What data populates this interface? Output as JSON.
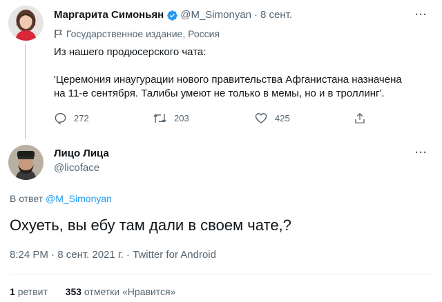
{
  "tweet1": {
    "author_name": "Маргарита Симоньян",
    "author_handle": "@M_Simonyan",
    "separator": "·",
    "date": "8 сент.",
    "label": "Государственное издание, Россия",
    "text_line1": "Из нашего продюсерского чата:",
    "text_line2": "'Церемония инаугурации нового правительства Афганистана назначена",
    "text_line3": "на 11-е сентября. Талибы умеют не только в мемы, но и в троллинг'.",
    "replies": "272",
    "retweets": "203",
    "likes": "425",
    "icons": [
      "verified-badge-icon",
      "flag-icon",
      "reply-icon",
      "retweet-icon",
      "like-icon",
      "share-icon",
      "more-icon"
    ]
  },
  "tweet2": {
    "author_name": "Лицо Лица",
    "author_handle": "@licoface",
    "reply_prefix": "В ответ",
    "reply_handle": "@M_Simonyan",
    "text": "Охуеть, вы ебу там дали в своем чате,?",
    "time": "8:24 PM",
    "separator": "·",
    "date": "8 сент. 2021 г.",
    "separator2": "·",
    "source": "Twitter for Android",
    "retweet_count": "1",
    "retweet_label": "ретвит",
    "like_count": "353",
    "like_label": "отметки «Нравится»"
  },
  "colors": {
    "accent": "#1d9bf0",
    "muted": "#536471",
    "text": "#0f1419",
    "divider": "#eff3f4"
  }
}
